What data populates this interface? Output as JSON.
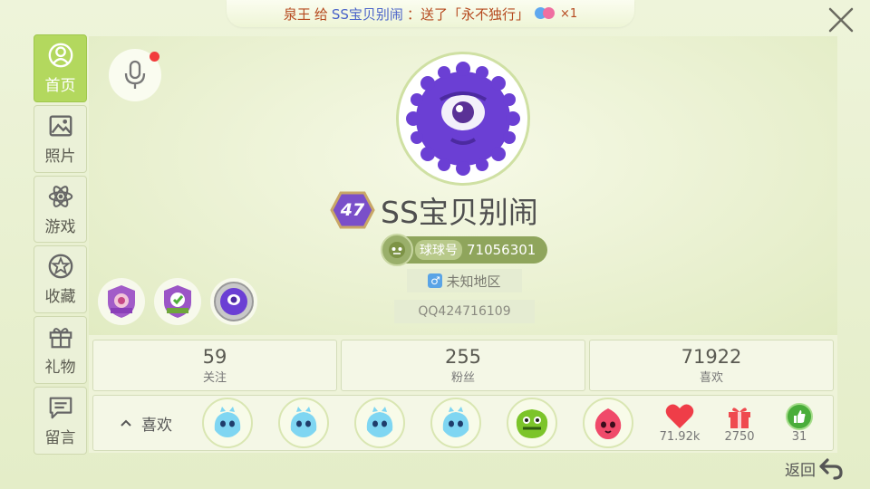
{
  "banner": {
    "sender": "泉王",
    "verb": "给",
    "recipient": "SS宝贝别闹",
    "action": "：送了「永不独行」",
    "count": "×1"
  },
  "nav": {
    "items": [
      {
        "label": "首页",
        "icon": "user-icon",
        "active": true
      },
      {
        "label": "照片",
        "icon": "photo-icon"
      },
      {
        "label": "游戏",
        "icon": "atom-icon"
      },
      {
        "label": "收藏",
        "icon": "star-badge-icon"
      },
      {
        "label": "礼物",
        "icon": "gift-icon"
      },
      {
        "label": "留言",
        "icon": "message-icon"
      }
    ]
  },
  "profile": {
    "level": "47",
    "username": "SS宝贝别闹",
    "id_label": "球球号",
    "id_value": "71056301",
    "location": "未知地区",
    "qq": "QQ424716109"
  },
  "stats": [
    {
      "value": "59",
      "label": "关注"
    },
    {
      "value": "255",
      "label": "粉丝"
    },
    {
      "value": "71922",
      "label": "喜欢"
    }
  ],
  "likes": {
    "label": "喜欢",
    "hearts": "71.92k",
    "gifts": "2750",
    "thumbs": "31"
  },
  "footer": {
    "back_label": "返回"
  },
  "colors": {
    "accent": "#b3d85e",
    "avatar": "#6d3fd1",
    "heart": "#ef3d48"
  }
}
